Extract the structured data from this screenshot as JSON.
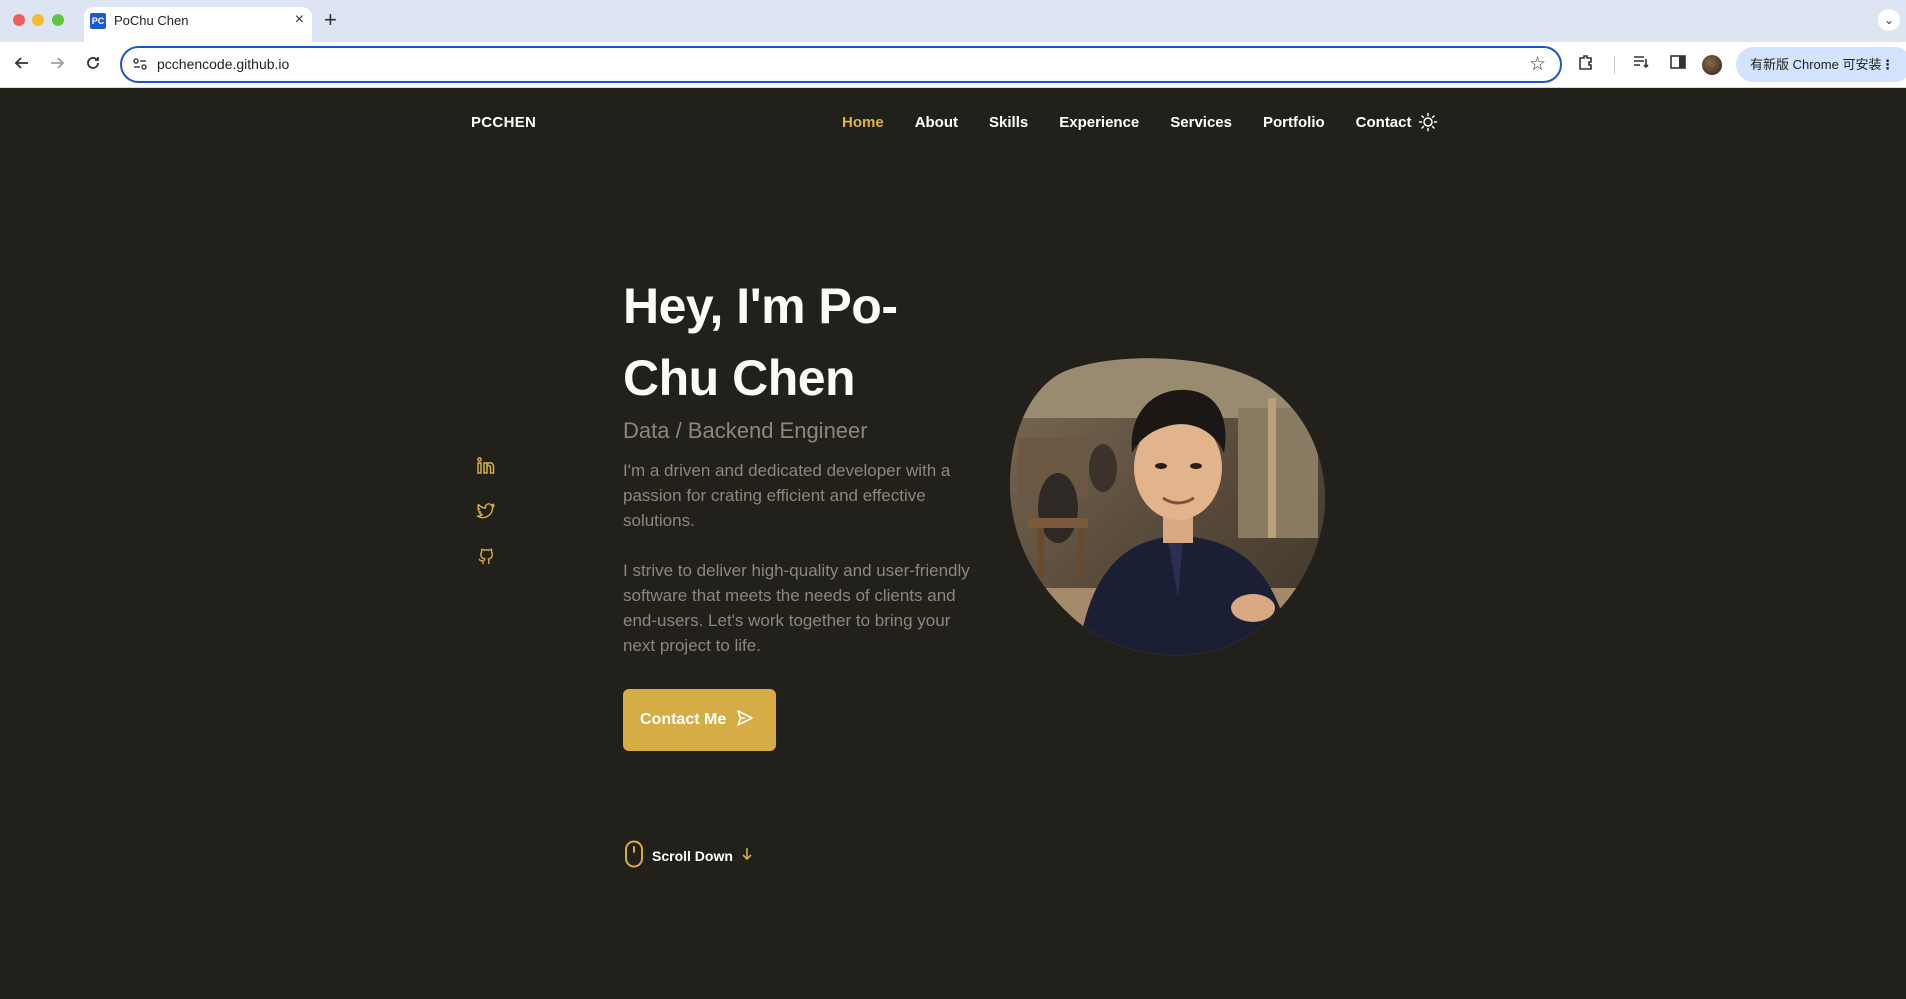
{
  "browser": {
    "tab": {
      "favicon_text": "PC",
      "title": "PoChu Chen",
      "close_glyph": "×"
    },
    "new_tab_glyph": "+",
    "url": "pcchencode.github.io",
    "update_pill_label": "有新版 Chrome 可安装",
    "icons": [
      "back-icon",
      "forward-icon",
      "reload-icon",
      "site-info-icon",
      "bookmark-star-icon",
      "extensions-icon",
      "reading-list-icon",
      "side-panel-icon",
      "profile-avatar",
      "menu-dots-icon"
    ]
  },
  "site": {
    "logo": "PCCHEN",
    "nav": {
      "home": "Home",
      "about": "About",
      "skills": "Skills",
      "experience": "Experience",
      "services": "Services",
      "portfolio": "Portfolio",
      "contact": "Contact"
    },
    "theme_icon": "sun-icon"
  },
  "hero": {
    "title": "Hey, I'm Po-Chu Chen",
    "subtitle": "Data / Backend Engineer",
    "paragraph1": "I'm a driven and dedicated developer with a passion for crating efficient and effective solutions.",
    "paragraph2": "I strive to deliver high-quality and user-friendly software that meets the needs of clients and end-users. Let's work together to bring your next project to life.",
    "cta": "Contact Me",
    "scroll": "Scroll Down",
    "socials": [
      "linkedin-icon",
      "twitter-icon",
      "github-icon"
    ]
  },
  "colors": {
    "background": "#22201a",
    "accent": "#d6ac45",
    "nav_active": "#e0b349",
    "muted_text": "#8c877a"
  }
}
